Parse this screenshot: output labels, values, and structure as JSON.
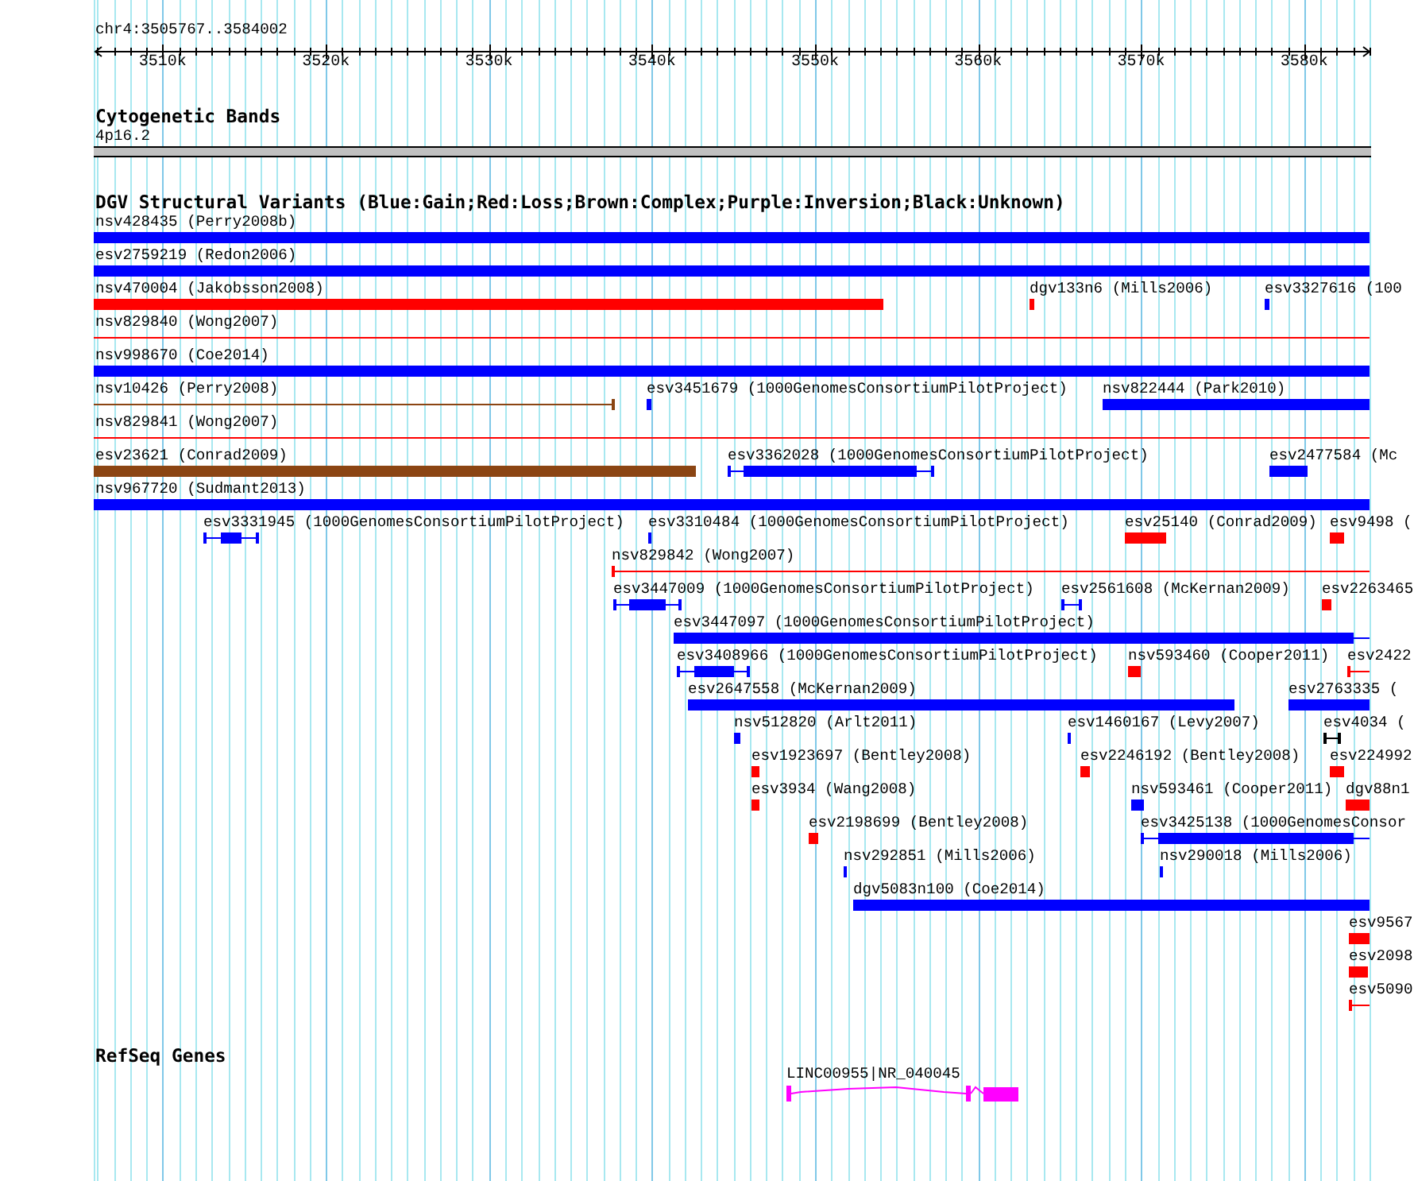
{
  "ruler": {
    "label": "chr4:3505767..3584002",
    "ticks": [
      "3510k",
      "3520k",
      "3530k",
      "3540k",
      "3550k",
      "3560k",
      "3570k",
      "3580k"
    ]
  },
  "tracks": [
    {
      "title": "Cytogenetic Bands",
      "features": [
        {
          "label": "4p16.2",
          "kind": "band"
        }
      ]
    },
    {
      "title": "DGV Structural Variants (Blue:Gain;Red:Loss;Brown:Complex;Purple:Inversion;Black:Unknown)",
      "features": [
        {
          "label": "nsv428435 (Perry2008b)",
          "kind": "bar",
          "color": "#0000ff"
        },
        {
          "label": "esv2759219 (Redon2006)",
          "kind": "bar",
          "color": "#0000ff"
        },
        {
          "label": "nsv470004 (Jakobsson2008)",
          "kind": "bar",
          "color": "#ff0000"
        },
        {
          "label": "dgv133n6 (Mills2006)",
          "kind": "bar",
          "color": "#ff0000"
        },
        {
          "label": "esv3327616 (100",
          "kind": "bar",
          "color": "#0000ff"
        },
        {
          "label": "nsv829840 (Wong2007)",
          "kind": "line",
          "color": "#ff0000"
        },
        {
          "label": "nsv998670 (Coe2014)",
          "kind": "bar",
          "color": "#0000ff"
        },
        {
          "label": "nsv10426 (Perry2008)",
          "kind": "line",
          "color": "#8b4513"
        },
        {
          "label": "esv3451679 (1000GenomesConsortiumPilotProject)",
          "kind": "bar",
          "color": "#0000ff"
        },
        {
          "label": "nsv822444 (Park2010)",
          "kind": "bar",
          "color": "#0000ff"
        },
        {
          "label": "nsv829841 (Wong2007)",
          "kind": "line",
          "color": "#ff0000"
        },
        {
          "label": "esv23621 (Conrad2009)",
          "kind": "bar",
          "color": "#8b4513"
        },
        {
          "label": "esv3362028 (1000GenomesConsortiumPilotProject)",
          "kind": "segmented",
          "color": "#0000ff"
        },
        {
          "label": "esv2477584 (Mc",
          "kind": "bar",
          "color": "#0000ff"
        },
        {
          "label": "nsv967720 (Sudmant2013)",
          "kind": "bar",
          "color": "#0000ff"
        },
        {
          "label": "esv3331945 (1000GenomesConsortiumPilotProject)",
          "kind": "segmented",
          "color": "#0000ff"
        },
        {
          "label": "esv3310484 (1000GenomesConsortiumPilotProject)",
          "kind": "bar",
          "color": "#0000ff"
        },
        {
          "label": "esv25140 (Conrad2009)",
          "kind": "bar",
          "color": "#ff0000"
        },
        {
          "label": "esv9498 (",
          "kind": "bar",
          "color": "#ff0000"
        },
        {
          "label": "nsv829842 (Wong2007)",
          "kind": "line",
          "color": "#ff0000"
        },
        {
          "label": "esv3447009 (1000GenomesConsortiumPilotProject)",
          "kind": "segmented",
          "color": "#0000ff"
        },
        {
          "label": "esv2561608 (McKernan2009)",
          "kind": "segmented",
          "color": "#0000ff"
        },
        {
          "label": "esv2263465",
          "kind": "bar",
          "color": "#ff0000"
        },
        {
          "label": "esv3447097 (1000GenomesConsortiumPilotProject)",
          "kind": "segmented",
          "color": "#0000ff"
        },
        {
          "label": "esv3408966 (1000GenomesConsortiumPilotProject)",
          "kind": "segmented",
          "color": "#0000ff"
        },
        {
          "label": "nsv593460 (Cooper2011)",
          "kind": "bar",
          "color": "#ff0000"
        },
        {
          "label": "esv2422",
          "kind": "line",
          "color": "#ff0000"
        },
        {
          "label": "esv2647558 (McKernan2009)",
          "kind": "bar",
          "color": "#0000ff"
        },
        {
          "label": "esv2763335 (",
          "kind": "bar",
          "color": "#0000ff"
        },
        {
          "label": "nsv512820 (Arlt2011)",
          "kind": "bar",
          "color": "#0000ff"
        },
        {
          "label": "esv1460167 (Levy2007)",
          "kind": "bar",
          "color": "#0000ff"
        },
        {
          "label": "esv4034 (",
          "kind": "segmented",
          "color": "#000000"
        },
        {
          "label": "esv1923697 (Bentley2008)",
          "kind": "bar",
          "color": "#ff0000"
        },
        {
          "label": "esv2246192 (Bentley2008)",
          "kind": "bar",
          "color": "#ff0000"
        },
        {
          "label": "esv224992",
          "kind": "bar",
          "color": "#ff0000"
        },
        {
          "label": "esv3934 (Wang2008)",
          "kind": "bar",
          "color": "#ff0000"
        },
        {
          "label": "nsv593461 (Cooper2011)",
          "kind": "bar",
          "color": "#0000ff"
        },
        {
          "label": "dgv88n1",
          "kind": "bar",
          "color": "#ff0000"
        },
        {
          "label": "esv2198699 (Bentley2008)",
          "kind": "bar",
          "color": "#ff0000"
        },
        {
          "label": "esv3425138 (1000GenomesConsor",
          "kind": "segmented",
          "color": "#0000ff"
        },
        {
          "label": "nsv292851 (Mills2006)",
          "kind": "bar",
          "color": "#0000ff"
        },
        {
          "label": "nsv290018 (Mills2006)",
          "kind": "bar",
          "color": "#0000ff"
        },
        {
          "label": "dgv5083n100 (Coe2014)",
          "kind": "bar",
          "color": "#0000ff"
        },
        {
          "label": "esv9567",
          "kind": "bar",
          "color": "#ff0000"
        },
        {
          "label": "esv2098",
          "kind": "bar",
          "color": "#ff0000"
        },
        {
          "label": "esv5090",
          "kind": "line",
          "color": "#ff0000"
        }
      ]
    },
    {
      "title": "RefSeq Genes",
      "features": [
        {
          "label": "LINC00955|NR_040045",
          "kind": "gene"
        }
      ]
    }
  ]
}
